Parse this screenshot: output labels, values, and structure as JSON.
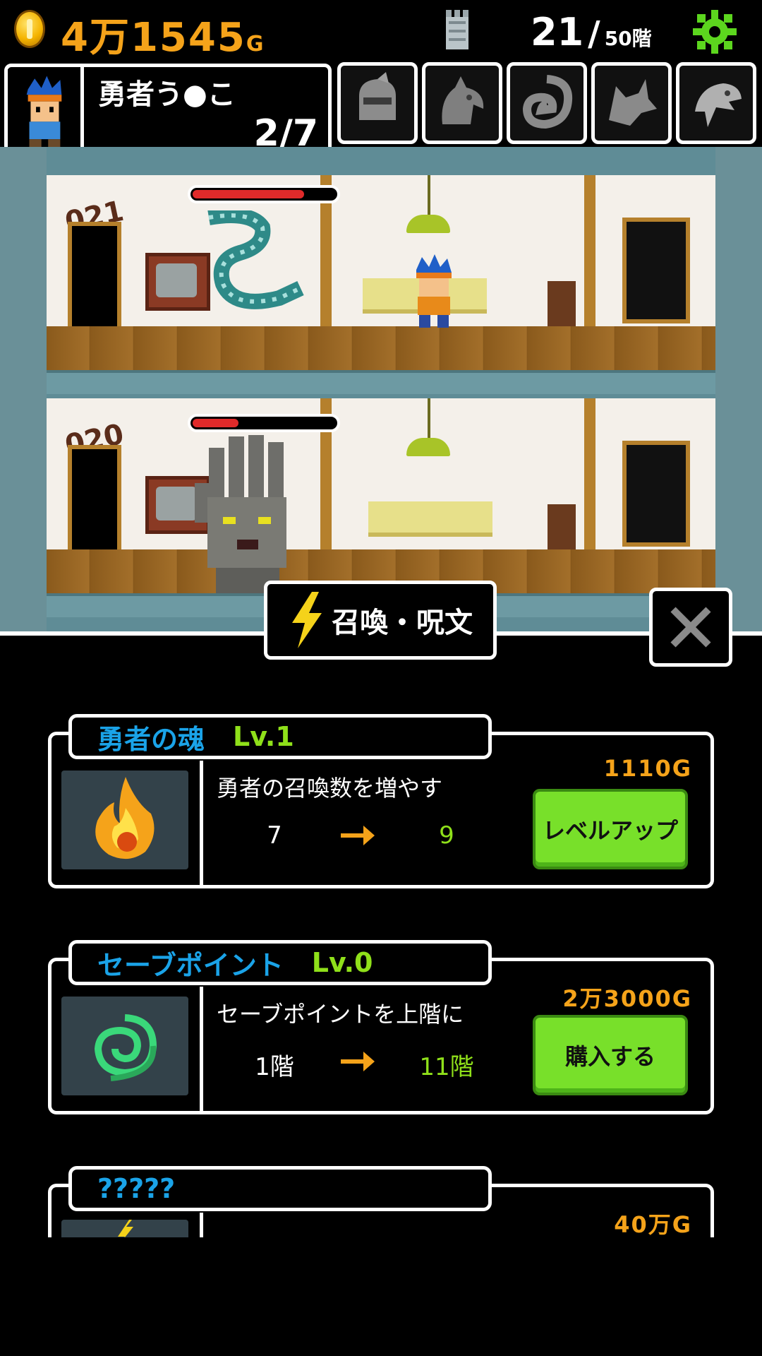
{
  "hud": {
    "gold": "4万1545",
    "gold_unit": "G",
    "floor_current": "21",
    "floor_sep": "/",
    "floor_max": "50階"
  },
  "hero": {
    "name": "勇者う●こ",
    "count": "2/7"
  },
  "summon_slots": [
    "knight-icon",
    "dragon-icon",
    "serpent-icon",
    "wolf-icon",
    "eagle-icon"
  ],
  "floors": [
    {
      "number": "021",
      "boss_hp_fraction": 0.78
    },
    {
      "number": "020",
      "boss_hp_fraction": 0.32
    }
  ],
  "menu": {
    "title": "召喚・呪文",
    "close_icon": "close-icon"
  },
  "upgrades": [
    {
      "name": "勇者の魂",
      "level": "Lv.1",
      "price": "1110G",
      "description": "勇者の召喚数を増やす",
      "from": "7",
      "to": "9",
      "button": "レベルアップ",
      "icon": "flame-icon"
    },
    {
      "name": "セーブポイント",
      "level": "Lv.0",
      "price": "2万3000G",
      "description": "セーブポイントを上階に",
      "from": "1階",
      "to": "11階",
      "button": "購入する",
      "icon": "swirl-icon"
    },
    {
      "name": "?????",
      "level": "",
      "price": "40万G",
      "icon": "lightning-icon"
    }
  ],
  "colors": {
    "gold": "#f5a31a",
    "name_blue": "#1aa3e8",
    "level_green": "#8fe01a",
    "button_green": "#78e02a",
    "hp_red": "#e02a2a"
  }
}
